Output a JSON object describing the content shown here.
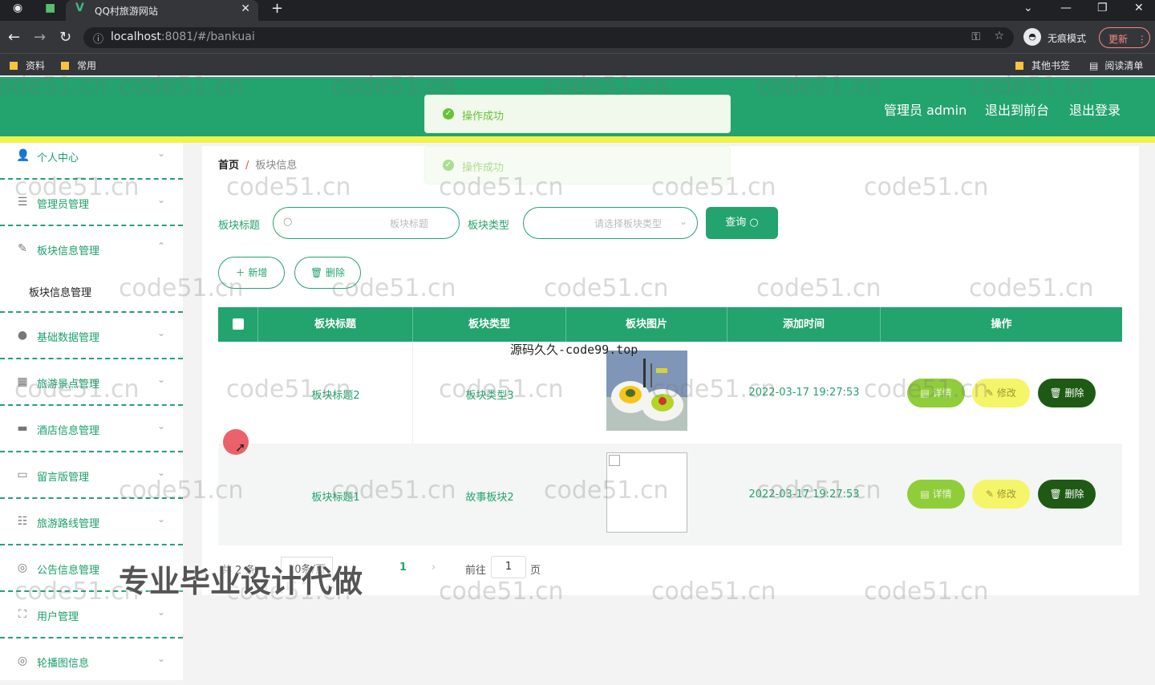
{
  "browser": {
    "tab_title": "QQ村旅游网站",
    "url_host": "localhost",
    "url_rest": ":8081/#/bankuai",
    "incognito_label": "无痕模式",
    "update_label": "更新",
    "bookmarks": [
      "资料",
      "常用"
    ],
    "bookmarks_right": [
      "其他书签",
      "阅读清单"
    ]
  },
  "header": {
    "admin_label": "管理员 admin",
    "back_front": "退出到前台",
    "logout": "退出登录"
  },
  "toasts": [
    "操作成功",
    "操作成功"
  ],
  "sidebar": {
    "items": [
      {
        "label": "个人中心",
        "icon": "user-icon",
        "chev": "⌄"
      },
      {
        "label": "管理员管理",
        "icon": "list-icon",
        "chev": "⌄"
      },
      {
        "label": "板块信息管理",
        "icon": "edit-icon",
        "chev": "⌃"
      },
      {
        "label": "基础数据管理",
        "icon": "pin-icon",
        "chev": "⌄"
      },
      {
        "label": "旅游景点管理",
        "icon": "grid-icon",
        "chev": "⌄"
      },
      {
        "label": "酒店信息管理",
        "icon": "bed-icon",
        "chev": "⌄"
      },
      {
        "label": "留言版管理",
        "icon": "message-icon",
        "chev": "⌄"
      },
      {
        "label": "旅游路线管理",
        "icon": "sliders-icon",
        "chev": "⌄"
      },
      {
        "label": "公告信息管理",
        "icon": "announce-icon",
        "chev": "⌄"
      },
      {
        "label": "用户管理",
        "icon": "users-icon",
        "chev": "⌄"
      },
      {
        "label": "轮播图信息",
        "icon": "carousel-icon",
        "chev": "⌄"
      }
    ],
    "submenu_label": "板块信息管理"
  },
  "breadcrumb": {
    "home": "首页",
    "current": "板块信息"
  },
  "filters": {
    "title_label": "板块标题",
    "title_placeholder": "板块标题",
    "type_label": "板块类型",
    "type_placeholder": "请选择板块类型",
    "query_button": "查询"
  },
  "actions": {
    "add": "新增",
    "delete": "删除"
  },
  "table": {
    "columns": [
      "板块标题",
      "板块类型",
      "板块图片",
      "添加时间",
      "操作"
    ],
    "rows": [
      {
        "title": "板块标题2",
        "type": "板块类型3",
        "time": "2022-03-17 19:27:53"
      },
      {
        "title": "板块标题1",
        "type": "故事板块2",
        "time": "2022-03-17 19:27:53"
      }
    ],
    "btn_detail": "详情",
    "btn_edit": "修改",
    "btn_delete": "删除"
  },
  "pagination": {
    "total": "共 2 条",
    "page_size": "10条/页",
    "current_page": "1",
    "goto_label": "前往",
    "goto_value": "1",
    "page_suffix": "页"
  },
  "overlays": {
    "site_text": "源码久久-code99.top",
    "promo": "专业毕业设计代做",
    "watermark": "code51.cn"
  },
  "colors": {
    "primary": "#23a36e",
    "accent_yellow": "#f2f24a",
    "detail": "#8fcd3a",
    "edit": "#f5f56a",
    "delete": "#1e5a14"
  }
}
